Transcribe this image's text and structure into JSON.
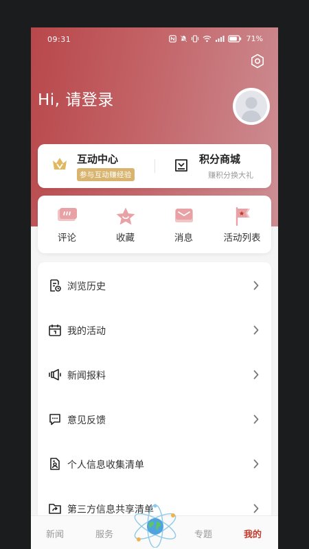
{
  "status_bar": {
    "time": "09:31",
    "battery_percent": "71%",
    "icons": [
      "nfc-icon",
      "mute-icon",
      "vibrate-icon",
      "wifi-icon",
      "signal-icon",
      "battery-icon"
    ]
  },
  "header": {
    "greeting": "Hi, 请登录",
    "settings_icon": "gear-icon",
    "avatar_icon": "default-avatar-icon"
  },
  "feature_card": {
    "left": {
      "icon": "crown-icon",
      "title": "互动中心",
      "badge": "参与互动赚经验"
    },
    "right": {
      "icon": "shop-icon",
      "title": "积分商城",
      "subtitle": "赚积分换大礼"
    }
  },
  "quick_actions": [
    {
      "icon": "comment-icon",
      "label": "评论"
    },
    {
      "icon": "star-icon",
      "label": "收藏"
    },
    {
      "icon": "envelope-icon",
      "label": "消息"
    },
    {
      "icon": "flag-icon",
      "label": "活动列表"
    }
  ],
  "menu": [
    {
      "icon": "history-icon",
      "label": "浏览历史"
    },
    {
      "icon": "calendar-icon",
      "label": "我的活动"
    },
    {
      "icon": "broadcast-icon",
      "label": "新闻报料"
    },
    {
      "icon": "feedback-icon",
      "label": "意见反馈"
    },
    {
      "icon": "personal-info-icon",
      "label": "个人信息收集清单"
    },
    {
      "icon": "share-folder-icon",
      "label": "第三方信息共享清单"
    }
  ],
  "tabbar": {
    "tabs": [
      {
        "label": "新闻",
        "active": false
      },
      {
        "label": "服务",
        "active": false
      },
      {
        "label": "专题",
        "active": false
      },
      {
        "label": "我的",
        "active": true
      }
    ],
    "center_icon": "atom-globe-icon"
  },
  "colors": {
    "brand_red": "#c0392b",
    "hero_start": "#b8474a",
    "hero_end": "#cd8f94",
    "badge_gold": "#d8b46f"
  }
}
